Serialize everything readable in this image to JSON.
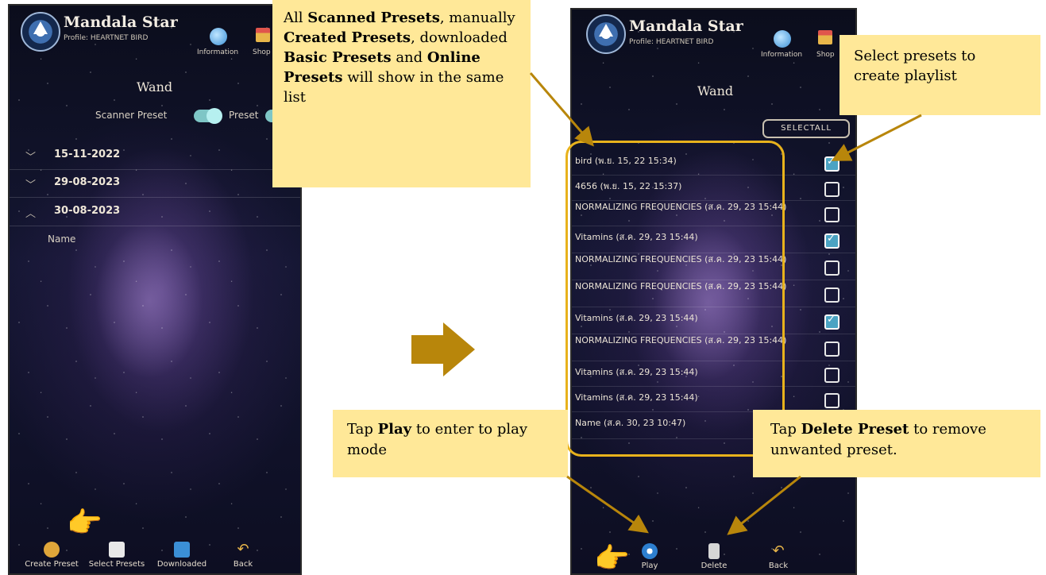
{
  "left_phone": {
    "app_title": "Mandala Star",
    "profile": "Profile: HEARTNET BIRD",
    "header_icons": [
      "Information",
      "Shop"
    ],
    "screen_title": "Wand",
    "toggles": [
      {
        "label": "Scanner Preset",
        "on": true
      },
      {
        "label": "Preset",
        "on": true
      }
    ],
    "dates": [
      {
        "chevron": "﹀",
        "date": "15-11-2022"
      },
      {
        "chevron": "﹀",
        "date": "29-08-2023"
      },
      {
        "chevron": "︿",
        "date": "30-08-2023"
      }
    ],
    "expanded_item": "Name",
    "bottom_bar": [
      "Create Preset",
      "Select Presets",
      "Downloaded",
      "Back"
    ]
  },
  "right_phone": {
    "app_title": "Mandala Star",
    "profile": "Profile: HEARTNET BIRD",
    "header_icons": [
      "Information",
      "Shop"
    ],
    "screen_title": "Wand",
    "select_all": "SELECTALL",
    "presets": [
      {
        "label": "bird (พ.ย. 15, 22 15:34)",
        "checked": true
      },
      {
        "label": "4656 (พ.ย. 15, 22 15:37)",
        "checked": false
      },
      {
        "label": "NORMALIZING FREQUENCIES (ส.ค. 29, 23 15:44)",
        "checked": false
      },
      {
        "label": "Vitamins (ส.ค. 29, 23 15:44)",
        "checked": true
      },
      {
        "label": "NORMALIZING FREQUENCIES (ส.ค. 29, 23 15:44)",
        "checked": false
      },
      {
        "label": "NORMALIZING FREQUENCIES (ส.ค. 29, 23 15:44)",
        "checked": false
      },
      {
        "label": "Vitamins (ส.ค. 29, 23 15:44)",
        "checked": true
      },
      {
        "label": "NORMALIZING FREQUENCIES (ส.ค. 29, 23 15:44)",
        "checked": false
      },
      {
        "label": "Vitamins (ส.ค. 29, 23 15:44)",
        "checked": false
      },
      {
        "label": "Vitamins (ส.ค. 29, 23 15:44)",
        "checked": false
      },
      {
        "label": "Name (ส.ค. 30, 23 10:47)",
        "checked": null
      }
    ],
    "bottom_bar": [
      "Play",
      "Delete",
      "Back"
    ]
  },
  "callouts": {
    "list_info": {
      "parts": [
        {
          "t": "All ",
          "b": false
        },
        {
          "t": "Scanned Presets",
          "b": true
        },
        {
          "t": ", manually ",
          "b": false
        },
        {
          "t": "Created Presets",
          "b": true
        },
        {
          "t": ", downloaded ",
          "b": false
        },
        {
          "t": "Basic Presets",
          "b": true
        },
        {
          "t": " and ",
          "b": false
        },
        {
          "t": "Online Presets",
          "b": true
        },
        {
          "t": " will show in the same list",
          "b": false
        }
      ]
    },
    "select_info": {
      "parts": [
        {
          "t": "Select presets to create playlist",
          "b": false
        }
      ]
    },
    "play_info": {
      "parts": [
        {
          "t": "Tap ",
          "b": false
        },
        {
          "t": "Play",
          "b": true
        },
        {
          "t": " to enter to play mode",
          "b": false
        }
      ]
    },
    "delete_info": {
      "parts": [
        {
          "t": "Tap ",
          "b": false
        },
        {
          "t": "Delete Preset",
          "b": true
        },
        {
          "t": " to remove unwanted preset.",
          "b": false
        }
      ]
    }
  },
  "colors": {
    "callout_bg": "#ffe898",
    "accent": "#b8860b",
    "frame": "#e8b21c",
    "checkbox_on": "#4ba3c3"
  }
}
